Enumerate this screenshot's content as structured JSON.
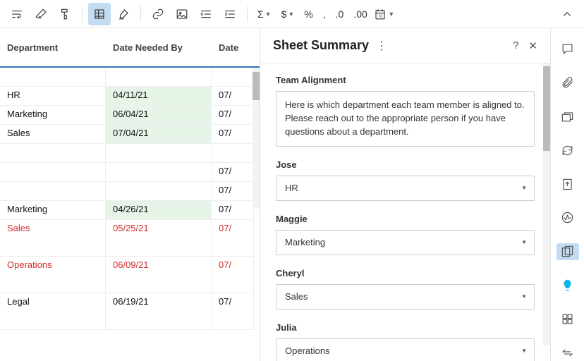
{
  "toolbar": {
    "sigma": "Σ",
    "dollar": "$",
    "percent": "%",
    "comma": ",",
    "dec_dec": ".0",
    "inc_dec": ".00"
  },
  "sheet": {
    "columns": [
      "Department",
      "Date Needed By",
      "Date"
    ],
    "rows": [
      {
        "c1": "",
        "c2": "",
        "c3": "",
        "tall": false,
        "green": false,
        "red": false
      },
      {
        "c1": "HR",
        "c2": "04/11/21",
        "c3": "07/",
        "tall": false,
        "green": true,
        "red": false
      },
      {
        "c1": "Marketing",
        "c2": "06/04/21",
        "c3": "07/",
        "tall": false,
        "green": true,
        "red": false
      },
      {
        "c1": "Sales",
        "c2": "07/04/21",
        "c3": "07/",
        "tall": false,
        "green": true,
        "red": false
      },
      {
        "c1": "",
        "c2": "",
        "c3": "",
        "tall": false,
        "green": false,
        "red": false
      },
      {
        "c1": "",
        "c2": "",
        "c3": "07/",
        "tall": false,
        "green": false,
        "red": false
      },
      {
        "c1": "",
        "c2": "",
        "c3": "07/",
        "tall": false,
        "green": false,
        "red": false
      },
      {
        "c1": "Marketing",
        "c2": "04/26/21",
        "c3": "07/",
        "tall": false,
        "green": true,
        "red": false
      },
      {
        "c1": "Sales",
        "c2": "05/25/21",
        "c3": "07/",
        "tall": true,
        "green": false,
        "red": true
      },
      {
        "c1": "Operations",
        "c2": "06/09/21",
        "c3": "07/",
        "tall": true,
        "green": false,
        "red": true
      },
      {
        "c1": "Legal",
        "c2": "06/19/21",
        "c3": "07/",
        "tall": true,
        "green": false,
        "red": false
      }
    ]
  },
  "summary": {
    "title": "Sheet Summary",
    "fields": [
      {
        "type": "text",
        "label": "Team Alignment",
        "value": "Here is which department each team member is aligned to. Please reach out to the appropriate person if you have questions about a department."
      },
      {
        "type": "select",
        "label": "Jose",
        "value": "HR"
      },
      {
        "type": "select",
        "label": "Maggie",
        "value": "Marketing"
      },
      {
        "type": "select",
        "label": "Cheryl",
        "value": "Sales"
      },
      {
        "type": "select",
        "label": "Julia",
        "value": "Operations"
      }
    ]
  }
}
